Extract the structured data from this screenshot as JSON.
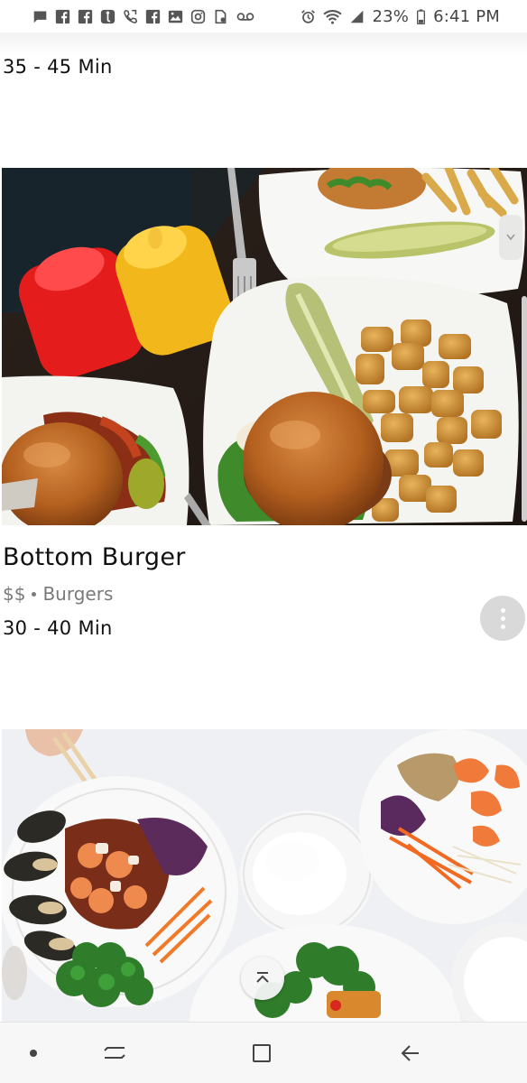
{
  "status_bar": {
    "battery_percent": "23%",
    "time": "6:41 PM",
    "notification_icons": [
      "message-icon",
      "facebook-icon",
      "facebook-icon",
      "tumblr-icon",
      "call-icon",
      "facebook-icon",
      "image-icon",
      "instagram-icon",
      "file-icon",
      "voicemail-icon"
    ],
    "system_icons": [
      "alarm-icon",
      "wifi-icon",
      "signal-icon",
      "battery-icon"
    ]
  },
  "feed": {
    "previous_card": {
      "eta": "35 - 45 Min"
    },
    "cards": [
      {
        "name": "Bottom Burger",
        "price_level": "$$",
        "cuisine": "Burgers",
        "eta": "30 - 40 Min",
        "photo_icon": "burger-photo"
      },
      {
        "photo_icon": "asian-dishes-photo"
      }
    ]
  },
  "colors": {
    "text_primary": "#111111",
    "text_secondary": "#7a7a7a",
    "more_button_bg": "#d9d9d9",
    "nav_bar_bg": "#f7f7f7"
  },
  "navigation_bar": {
    "buttons": [
      "recents-dot-icon",
      "recent-apps-icon",
      "home-icon",
      "back-icon"
    ]
  }
}
